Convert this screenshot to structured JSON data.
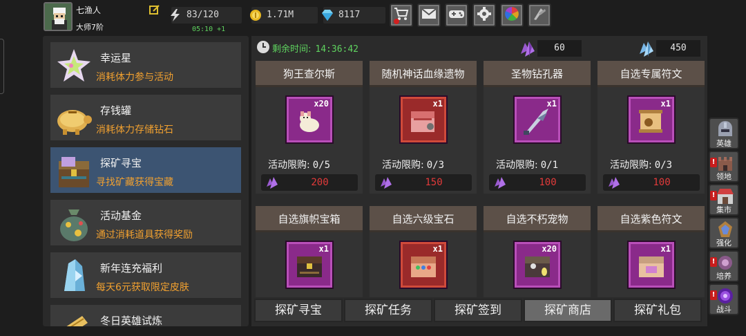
{
  "player": {
    "name": "七渔人",
    "rank": "大师7阶"
  },
  "resources": {
    "energy": "83/120",
    "energy_timer": "05:10 +1",
    "gold": "1.71M",
    "diamonds": "8117"
  },
  "toolbar": [
    "shop-cart-icon",
    "mail-icon",
    "gamepad-icon",
    "gear-icon",
    "color-wheel-icon",
    "crystal-icon"
  ],
  "activities": [
    {
      "title": "幸运星",
      "desc": "消耗体力参与活动"
    },
    {
      "title": "存钱罐",
      "desc": "消耗体力存储钻石"
    },
    {
      "title": "探矿寻宝",
      "desc": "寻找矿藏获得宝藏",
      "selected": true
    },
    {
      "title": "活动基金",
      "desc": "通过消耗道具获得奖励"
    },
    {
      "title": "新年连充福利",
      "desc": "每天6元获取限定皮肤"
    },
    {
      "title": "冬日英雄试炼",
      "desc": ""
    }
  ],
  "shop": {
    "remaining_label": "剩余时间:",
    "remaining_time": "14:36:42",
    "currency_purple": "60",
    "currency_blue": "450",
    "limit_label": "活动限购:",
    "items": [
      {
        "name": "狗王查尔斯",
        "qty": "x20",
        "limit": "0/5",
        "price": "200"
      },
      {
        "name": "随机神话血缘遗物",
        "qty": "x1",
        "limit": "0/3",
        "price": "150"
      },
      {
        "name": "圣物钻孔器",
        "qty": "x1",
        "limit": "0/1",
        "price": "100"
      },
      {
        "name": "自选专属符文",
        "qty": "x1",
        "limit": "0/3",
        "price": "100"
      },
      {
        "name": "自选旗帜宝箱",
        "qty": "x1"
      },
      {
        "name": "自选六级宝石",
        "qty": "x1"
      },
      {
        "name": "自选不朽宠物",
        "qty": "x20"
      },
      {
        "name": "自选紫色符文",
        "qty": "x1"
      }
    ]
  },
  "tabs": [
    "探矿寻宝",
    "探矿任务",
    "探矿签到",
    "探矿商店",
    "探矿礼包"
  ],
  "active_tab": "探矿商店",
  "side_nav": [
    {
      "label": "英雄",
      "icon": "helmet-icon"
    },
    {
      "label": "领地",
      "icon": "castle-icon",
      "alert": "!"
    },
    {
      "label": "集市",
      "icon": "market-icon",
      "alert": "!"
    },
    {
      "label": "强化",
      "icon": "enhance-icon"
    },
    {
      "label": "培养",
      "icon": "train-icon",
      "alert": "!"
    },
    {
      "label": "战斗",
      "icon": "portal-icon",
      "alert": "!"
    }
  ],
  "colors": {
    "accent_green": "#5fd35f",
    "price_red": "#e33a3a",
    "desc_orange": "#f0a030",
    "selected_blue": "#3c5472"
  }
}
